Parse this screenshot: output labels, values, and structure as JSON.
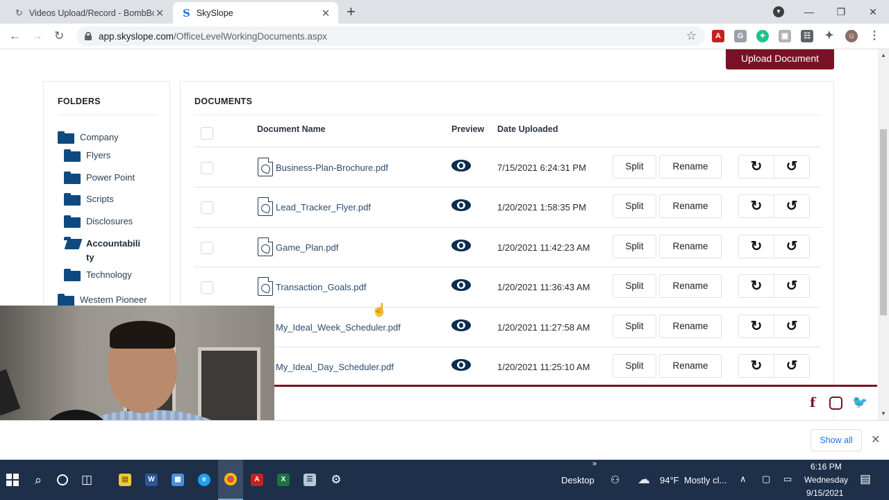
{
  "browser": {
    "tabs": [
      {
        "title": "Videos Upload/Record - BombBomb",
        "active": false
      },
      {
        "title": "SkySlope",
        "active": true
      }
    ],
    "new_tab_icon": "plus-icon",
    "url_host": "app.skyslope.com",
    "url_path": "/OfficeLevelWorkingDocuments.aspx"
  },
  "page": {
    "upload_button": "Upload Document",
    "folders_title": "FOLDERS",
    "documents_title": "DOCUMENTS",
    "folders": [
      {
        "label": "Company",
        "level": 0
      },
      {
        "label": "Flyers",
        "level": 1
      },
      {
        "label": "Power Point",
        "level": 1
      },
      {
        "label": "Scripts",
        "level": 1
      },
      {
        "label": "Disclosures",
        "level": 1
      },
      {
        "label": "Accountability",
        "level": 1,
        "selected": true
      },
      {
        "label": "Technology",
        "level": 1
      },
      {
        "label": "Western Pioneer",
        "level": 0
      }
    ],
    "columns": {
      "name": "Document Name",
      "preview": "Preview",
      "date": "Date Uploaded"
    },
    "documents": [
      {
        "name": "Business-Plan-Brochure.pdf",
        "date": "7/15/2021 6:24:31 PM"
      },
      {
        "name": "Lead_Tracker_Flyer.pdf",
        "date": "1/20/2021 1:58:35 PM"
      },
      {
        "name": "Game_Plan.pdf",
        "date": "1/20/2021 11:42:23 AM"
      },
      {
        "name": "Transaction_Goals.pdf",
        "date": "1/20/2021 11:36:43 AM"
      },
      {
        "name": "My_Ideal_Week_Scheduler.pdf",
        "date": "1/20/2021 11:27:58 AM"
      },
      {
        "name": "My_Ideal_Day_Scheduler.pdf",
        "date": "1/20/2021 11:25:10 AM"
      }
    ],
    "split_label": "Split",
    "rename_label": "Rename",
    "social_icons": [
      "facebook-icon",
      "instagram-icon",
      "twitter-icon"
    ],
    "accent_color": "#7b1126"
  },
  "downloads": {
    "show_all": "Show all"
  },
  "taskbar": {
    "desktop_label": "Desktop",
    "weather_temp": "94°F",
    "weather_text": "Mostly cl...",
    "time": "6:16 PM",
    "day": "Wednesday",
    "date": "9/15/2021"
  }
}
